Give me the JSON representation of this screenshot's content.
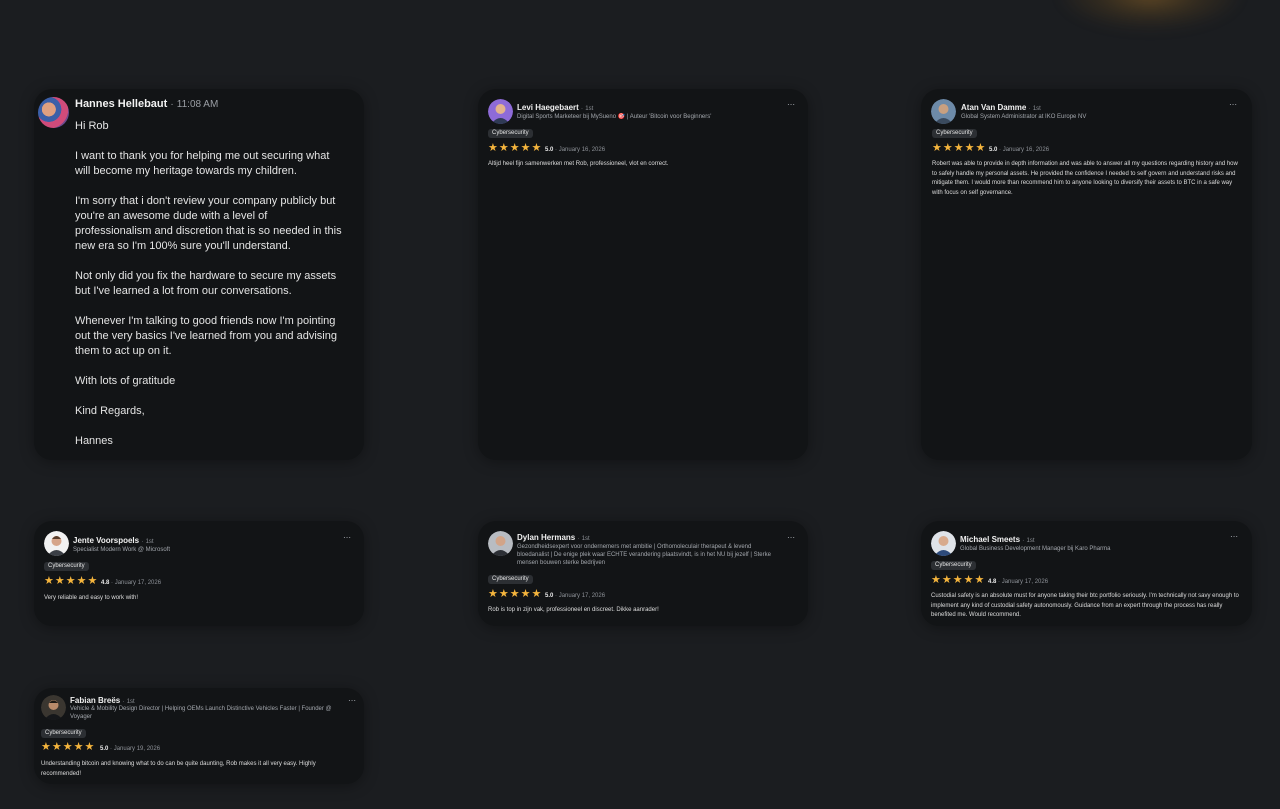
{
  "message": {
    "name": "Hannes Hellebaut",
    "time": "11:08 AM",
    "paragraphs": [
      "Hi Rob",
      "I want to thank you for helping me out securing what will become my heritage towards my children.",
      "I'm sorry that i don't review your company publicly but you're an awesome dude with a level of professionalism and discretion that is so needed in this new era so I'm 100% sure you'll understand.",
      "Not only did you fix the hardware to secure my assets but I've learned a lot from our conversations.",
      "Whenever I'm talking to good friends now I'm pointing out the very basics I've learned from you and advising them to act up on it.",
      "With lots of gratitude",
      "Kind Regards,",
      "Hannes"
    ]
  },
  "reviews": [
    {
      "name": "Levi Haegebaert",
      "degree": "1st",
      "title": "Digital Sports Marketeer bij MySueno 🎯 | Auteur 'Bitcoin voor Beginners'",
      "tag": "Cybersecurity",
      "rating": "5.0",
      "date": "January 16, 2026",
      "text": "Altijd heel fijn samenwerken met Rob, professioneel, vlot en correct."
    },
    {
      "name": "Atan Van Damme",
      "degree": "1st",
      "title": "Global System Administrator at IKO Europe NV",
      "tag": "Cybersecurity",
      "rating": "5.0",
      "date": "January 16, 2026",
      "text": "Robert was able to provide in depth information and was able to answer all my questions regarding history and how to safely handle my personal assets. He provided the confidence I needed to self govern and understand risks and mitigate them. I would more than recommend him to anyone looking to diversify their assets to BTC in a safe way with focus on self governance."
    },
    {
      "name": "Jente Voorspoels",
      "degree": "1st",
      "title": "Specialist Modern Work @ Microsoft",
      "tag": "Cybersecurity",
      "rating": "4.8",
      "date": "January 17, 2026",
      "text": "Very reliable and easy to work with!"
    },
    {
      "name": "Dylan Hermans",
      "degree": "1st",
      "title": "Gezondheidsexpert voor ondernemers met ambitie | Orthomoleculair therapeut & levend bloedanalist | De enige plek waar ECHTE verandering plaatsvindt, is in het NU bij jezelf | Sterke mensen bouwen sterke bedrijven",
      "tag": "Cybersecurity",
      "rating": "5.0",
      "date": "January 17, 2026",
      "text": "Rob is top in zijn vak, professioneel en discreet. Dikke aanrader!"
    },
    {
      "name": "Michael Smeets",
      "degree": "1st",
      "title": "Global Business Development Manager bij Karo Pharma",
      "tag": "Cybersecurity",
      "rating": "4.8",
      "date": "January 17, 2026",
      "text": "Custodial safety is an absolute must for anyone taking their btc portfolio seriously. I'm technically not savy enough to implement any kind of custodial safety autonomously. Guidance from an expert through the process has really benefited me. Would recommend."
    },
    {
      "name": "Fabian Breës",
      "degree": "1st",
      "title": "Vehicle & Mobility Design Director | Helping OEMs Launch Distinctive Vehicles Faster | Founder @ Voyager",
      "tag": "Cybersecurity",
      "rating": "5.0",
      "date": "January 19, 2026",
      "text": "Understanding bitcoin and knowing what to do can be quite daunting, Rob makes it all very easy. Highly recommended!"
    }
  ],
  "ui": {
    "more_icon": "⋯",
    "star_icon": "★",
    "separator": "·"
  },
  "colors": {
    "background": "#1b1d20",
    "card": "#121416",
    "star": "#f5b53d",
    "tag_bg": "#2c2f33"
  }
}
